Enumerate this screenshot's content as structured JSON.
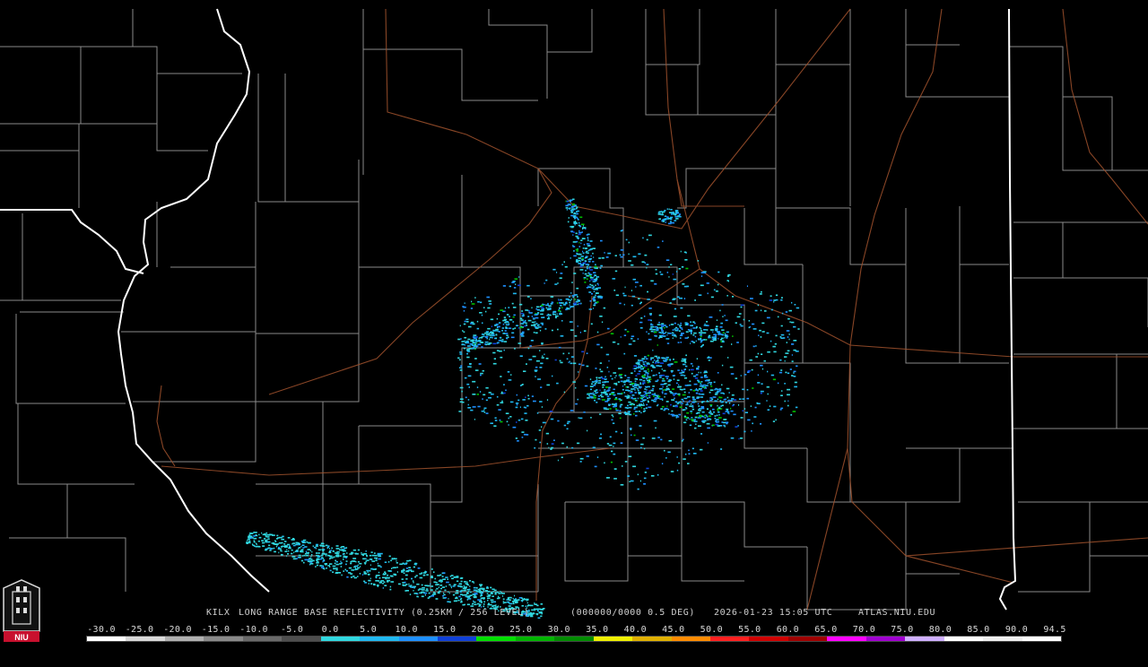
{
  "map": {
    "title_station": "KILX",
    "title_product": "LONG RANGE BASE REFLECTIVITY (0.25KM / 256 LEVEL)",
    "title_sweep": "(000000/0000 0.5 DEG)",
    "title_time": "2026-01-23 15:05 UTC",
    "title_source": "ATLAS.NIU.EDU",
    "logo_text": "NIU",
    "colors": {
      "background": "#000000",
      "county_lines": "#8a8a8a",
      "state_lines": "#ffffff",
      "highways": "#a0522d"
    }
  },
  "scale": {
    "labels": [
      "-30.0",
      "-25.0",
      "-20.0",
      "-15.0",
      "-10.0",
      "-5.0",
      "0.0",
      "5.0",
      "10.0",
      "15.0",
      "20.0",
      "25.0",
      "30.0",
      "35.0",
      "40.0",
      "45.0",
      "50.0",
      "55.0",
      "60.0",
      "65.0",
      "70.0",
      "75.0",
      "80.0",
      "85.0",
      "90.0",
      "94.5"
    ],
    "colors": [
      "#ffffff",
      "#d9d9d9",
      "#b0b0b0",
      "#8a8a8a",
      "#6a6a6a",
      "#4e4e4e",
      "#30d8e0",
      "#20b8f0",
      "#1e90ff",
      "#1040d8",
      "#00e000",
      "#00b400",
      "#008c00",
      "#f0f000",
      "#e0b000",
      "#ff8c00",
      "#ff2020",
      "#d00000",
      "#a00000",
      "#ff00ff",
      "#a000d0",
      "#d0b0ff",
      "#ffffff",
      "#f0f0f0",
      "#ffffff"
    ]
  }
}
